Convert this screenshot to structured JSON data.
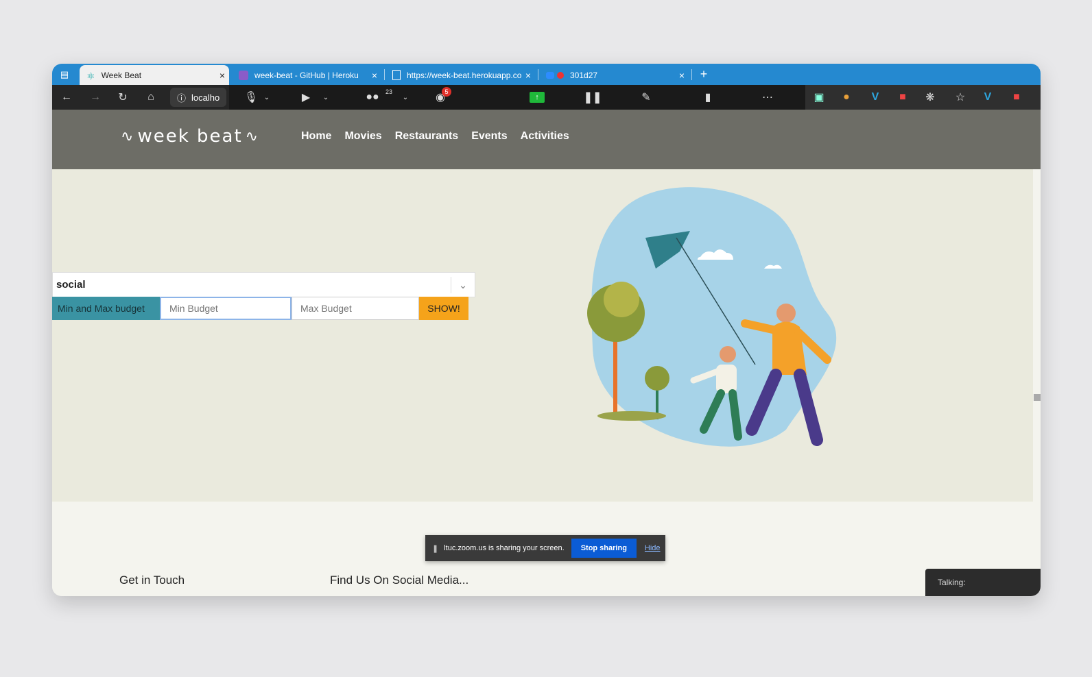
{
  "browser": {
    "tabs": [
      {
        "label": "Week Beat",
        "active": true
      },
      {
        "label": "week-beat - GitHub | Heroku",
        "active": false
      },
      {
        "label": "https://week-beat.herokuapp.co",
        "active": false
      },
      {
        "label": "301d27",
        "active": false
      }
    ],
    "new_tab": "+",
    "address": "localho"
  },
  "zoom_toolbar": {
    "participants_count": "23",
    "chat_badge": "5"
  },
  "site": {
    "logo_text": "week beat",
    "nav": [
      "Home",
      "Movies",
      "Restaurants",
      "Events",
      "Activities"
    ]
  },
  "filters": {
    "category_value": "social",
    "budget_label": "Min and Max budget",
    "min_placeholder": "Min Budget",
    "max_placeholder": "Max Budget",
    "show_label": "SHOW!"
  },
  "footer": {
    "get_in_touch": "Get in Touch",
    "social": "Find Us On Social Media..."
  },
  "share_bar": {
    "message": "ltuc.zoom.us is sharing your screen.",
    "stop_label": "Stop sharing",
    "hide_label": "Hide"
  },
  "talking": "Talking:",
  "colors": {
    "tabbar": "#2589d0",
    "header": "#6d6d66",
    "hero_bg": "#eaeadd",
    "budget_label_bg": "#3a93a3",
    "show_btn": "#f5a31a"
  }
}
